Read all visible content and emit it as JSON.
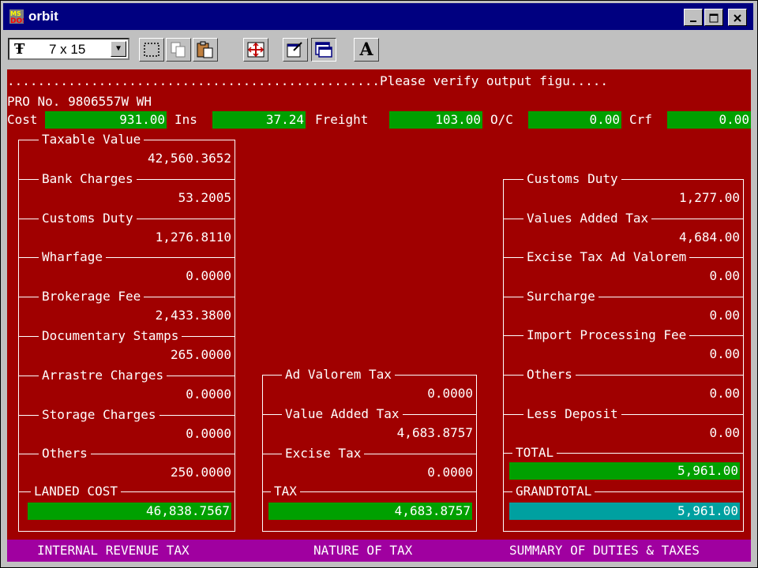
{
  "window": {
    "title": "orbit",
    "icon": "ms-dos-icon"
  },
  "toolbar": {
    "font_size": "7 x 15",
    "icons": [
      "mark-icon",
      "copy-icon",
      "paste-icon",
      "fullscreen-icon",
      "properties-icon",
      "background-icon",
      "font-icon"
    ],
    "font_button_label": "A"
  },
  "screen": {
    "message": ".................................................Please verify output figu.....",
    "pro_no": "PRO No. 9806557W WH",
    "cost_label": "Cost",
    "cost": "931.00",
    "ins_label": "Ins",
    "ins": "37.24",
    "freight_label": "Freight",
    "freight": "103.00",
    "oc_label": "O/C",
    "oc": "0.00",
    "crf_label": "Crf",
    "crf": "0.00"
  },
  "internal_revenue": {
    "items": [
      {
        "label": "Taxable Value",
        "value": "42,560.3652"
      },
      {
        "label": "Bank Charges",
        "value": "53.2005"
      },
      {
        "label": "Customs Duty",
        "value": "1,276.8110"
      },
      {
        "label": "Wharfage",
        "value": "0.0000"
      },
      {
        "label": "Brokerage Fee",
        "value": "2,433.3800"
      },
      {
        "label": "Documentary Stamps",
        "value": "265.0000"
      },
      {
        "label": "Arrastre Charges",
        "value": "0.0000"
      },
      {
        "label": "Storage Charges",
        "value": "0.0000"
      },
      {
        "label": "Others",
        "value": "250.0000"
      }
    ],
    "landed_label": "LANDED COST",
    "landed_value": "46,838.7567"
  },
  "nature_of_tax": {
    "items": [
      {
        "label": "Ad Valorem Tax",
        "value": "0.0000"
      },
      {
        "label": "Value Added Tax",
        "value": "4,683.8757"
      },
      {
        "label": "Excise Tax",
        "value": "0.0000"
      }
    ],
    "tax_label": "TAX",
    "tax_value": "4,683.8757"
  },
  "summary": {
    "items": [
      {
        "label": "Customs Duty",
        "value": "1,277.00"
      },
      {
        "label": "Values Added Tax",
        "value": "4,684.00"
      },
      {
        "label": "Excise Tax Ad Valorem",
        "value": "0.00"
      },
      {
        "label": "Surcharge",
        "value": "0.00"
      },
      {
        "label": "Import Processing Fee",
        "value": "0.00"
      },
      {
        "label": "Others",
        "value": "0.00"
      },
      {
        "label": "Less Deposit",
        "value": "0.00"
      }
    ],
    "total_label": "TOTAL",
    "total_value": "5,961.00",
    "grand_label": "GRANDTOTAL",
    "grand_value": "5,961.00"
  },
  "footer": {
    "left": "INTERNAL REVENUE TAX",
    "center": "NATURE OF TAX",
    "right": "SUMMARY OF DUTIES & TAXES"
  },
  "colors": {
    "screen_bg": "#a00000",
    "field_green": "#00a000",
    "grand_cyan": "#00a0a0",
    "footer_bg": "#a000a0",
    "title_bar": "#000080"
  }
}
